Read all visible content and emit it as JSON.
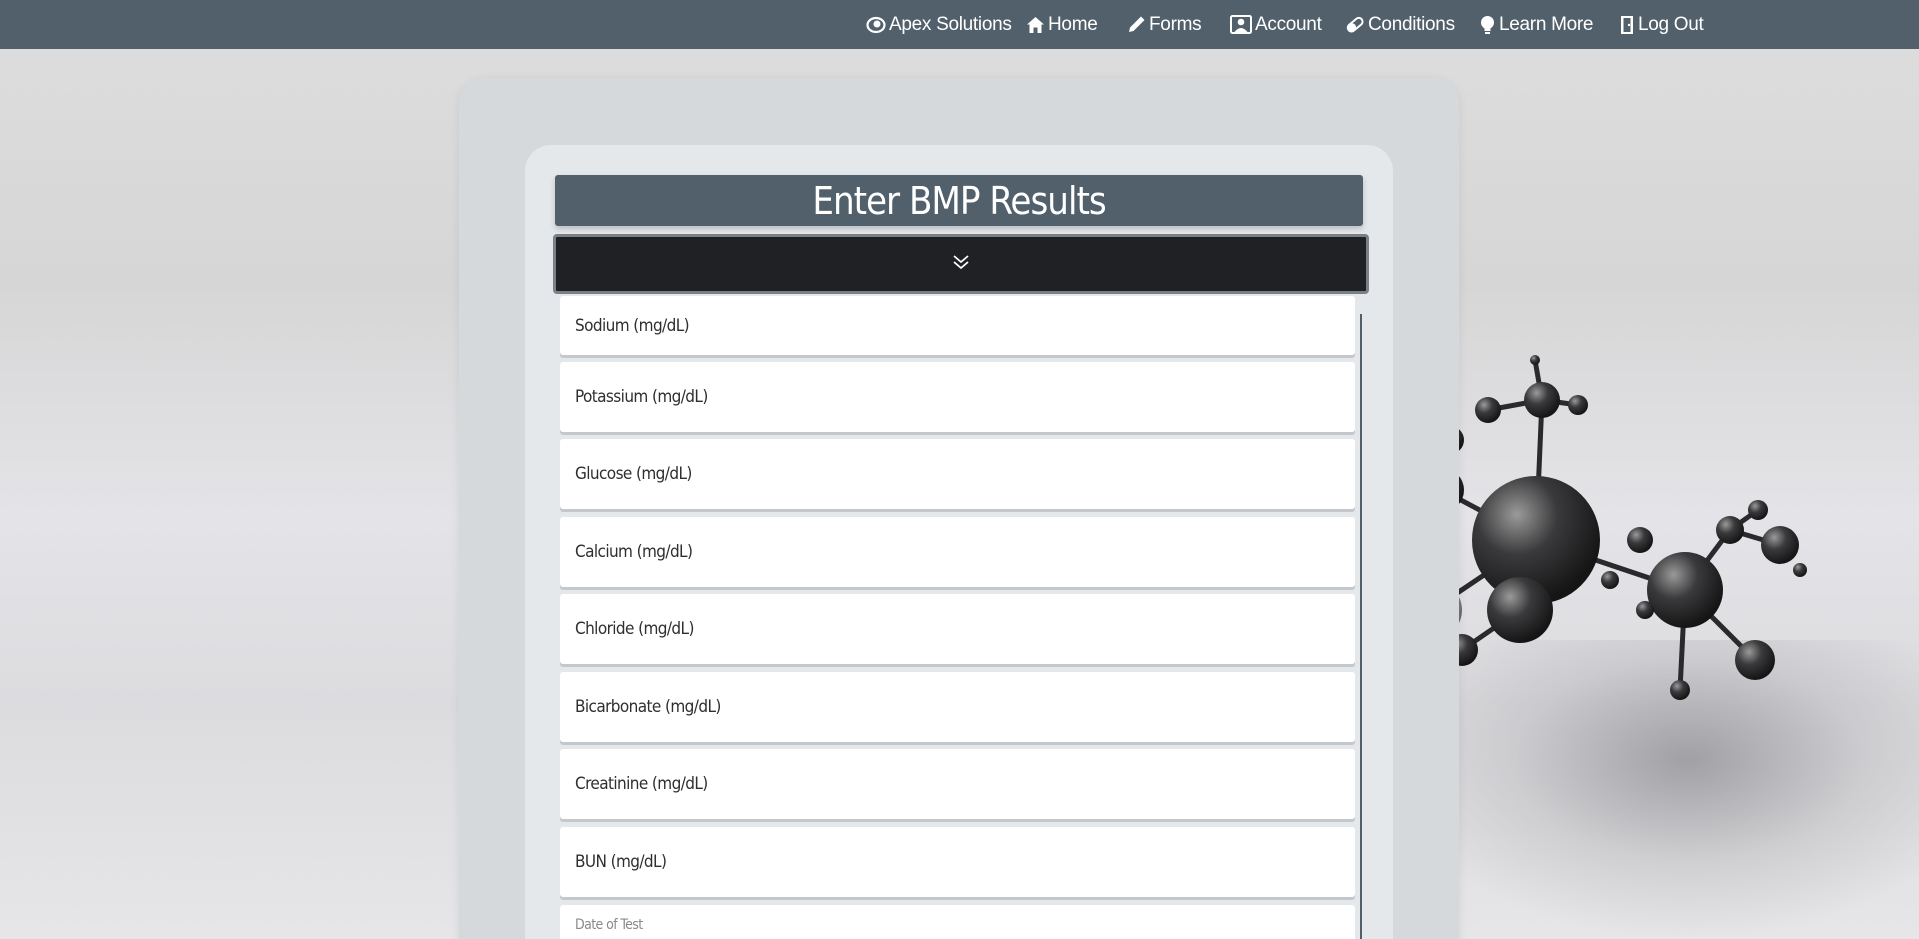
{
  "nav": {
    "brand": "Apex Solutions",
    "home": "Home",
    "forms": "Forms",
    "account": "Account",
    "conditions": "Conditions",
    "learn_more": "Learn More",
    "log_out": "Log Out"
  },
  "icons": {
    "brand": "eye-icon",
    "home": "home-icon",
    "forms": "pencil-icon",
    "account": "user-icon",
    "conditions": "pill-icon",
    "learn_more": "lightbulb-icon",
    "log_out": "door-icon",
    "toggle": "double-chevron-down-icon"
  },
  "colors": {
    "topbar": "#51606b",
    "title_bar": "#51606b",
    "toggle_bar": "#1f2124"
  },
  "form": {
    "title": "Enter BMP Results",
    "fields": [
      {
        "placeholder": "Sodium (mg/dL)"
      },
      {
        "placeholder": "Potassium (mg/dL)"
      },
      {
        "placeholder": "Glucose (mg/dL)"
      },
      {
        "placeholder": "Calcium (mg/dL)"
      },
      {
        "placeholder": "Chloride (mg/dL)"
      },
      {
        "placeholder": "Bicarbonate (mg/dL)"
      },
      {
        "placeholder": "Creatinine (mg/dL)"
      },
      {
        "placeholder": "BUN (mg/dL)"
      },
      {
        "placeholder": "Date of Test"
      }
    ]
  }
}
